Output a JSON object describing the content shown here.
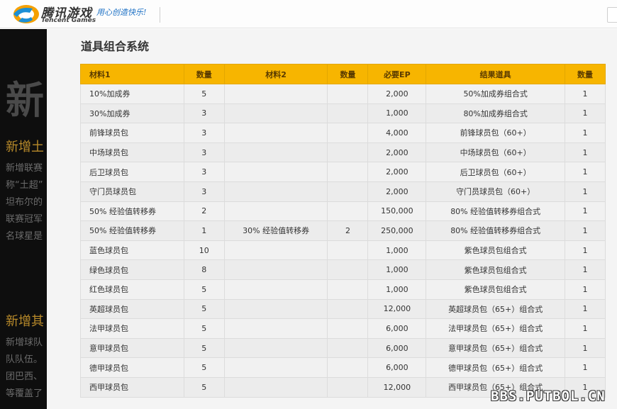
{
  "header": {
    "brand_cn": "腾讯游戏",
    "brand_en": "Tencent Games",
    "slogan": "用心创造快乐!"
  },
  "background": {
    "big_char": "新",
    "heading_1": "新增土",
    "lines_1": [
      "新增联赛",
      "称“土超”",
      "坦布尔的",
      "联赛冠军",
      "名球星是"
    ],
    "heading_2": "新增其",
    "lines_2": [
      "新增球队",
      "队队伍。",
      "团巴西、",
      "等覆盖了"
    ]
  },
  "modal": {
    "title": "道具组合系统",
    "columns": [
      "材料1",
      "数量",
      "材料2",
      "数量",
      "必要EP",
      "结果道具",
      "数量"
    ],
    "rows": [
      [
        "10%加成券",
        "5",
        "",
        "",
        "2,000",
        "50%加成券组合式",
        "1"
      ],
      [
        "30%加成券",
        "3",
        "",
        "",
        "1,000",
        "80%加成券组合式",
        "1"
      ],
      [
        "前锋球员包",
        "3",
        "",
        "",
        "4,000",
        "前锋球员包（60+）",
        "1"
      ],
      [
        "中场球员包",
        "3",
        "",
        "",
        "2,000",
        "中场球员包（60+）",
        "1"
      ],
      [
        "后卫球员包",
        "3",
        "",
        "",
        "2,000",
        "后卫球员包（60+）",
        "1"
      ],
      [
        "守门员球员包",
        "3",
        "",
        "",
        "2,000",
        "守门员球员包（60+）",
        "1"
      ],
      [
        "50% 经验值转移券",
        "2",
        "",
        "",
        "150,000",
        "80% 经验值转移券组合式",
        "1"
      ],
      [
        "50% 经验值转移券",
        "1",
        "30% 经验值转移券",
        "2",
        "250,000",
        "80% 经验值转移券组合式",
        "1"
      ],
      [
        "蓝色球员包",
        "10",
        "",
        "",
        "1,000",
        "紫色球员包组合式",
        "1"
      ],
      [
        "绿色球员包",
        "8",
        "",
        "",
        "1,000",
        "紫色球员包组合式",
        "1"
      ],
      [
        "红色球员包",
        "5",
        "",
        "",
        "1,000",
        "紫色球员包组合式",
        "1"
      ],
      [
        "英超球员包",
        "5",
        "",
        "",
        "12,000",
        "英超球员包（65+）组合式",
        "1"
      ],
      [
        "法甲球员包",
        "5",
        "",
        "",
        "6,000",
        "法甲球员包（65+）组合式",
        "1"
      ],
      [
        "意甲球员包",
        "5",
        "",
        "",
        "6,000",
        "意甲球员包（65+）组合式",
        "1"
      ],
      [
        "德甲球员包",
        "5",
        "",
        "",
        "6,000",
        "德甲球员包（65+）组合式",
        "1"
      ],
      [
        "西甲球员包",
        "5",
        "",
        "",
        "12,000",
        "西甲球员包（65+）组合式",
        "1"
      ]
    ]
  },
  "watermark": "BBS.PUTBOL.CN"
}
